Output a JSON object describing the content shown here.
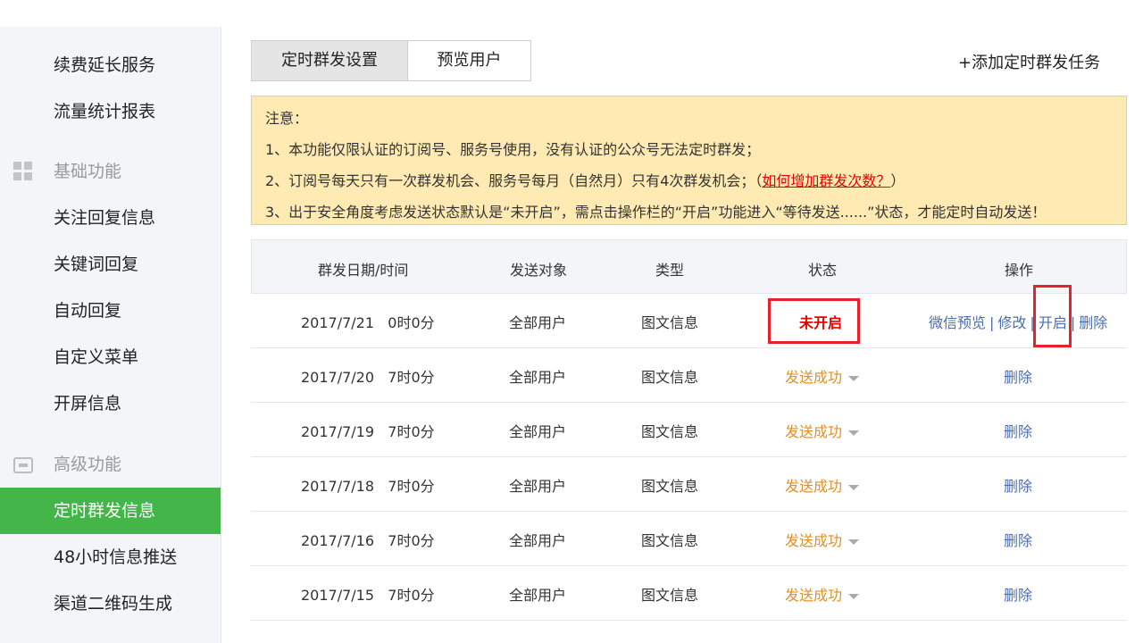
{
  "sidebar": {
    "items": [
      {
        "label": "续费延长服务"
      },
      {
        "label": "流量统计报表"
      },
      {
        "label": "基础功能"
      },
      {
        "label": "关注回复信息"
      },
      {
        "label": "关键词回复"
      },
      {
        "label": "自动回复"
      },
      {
        "label": "自定义菜单"
      },
      {
        "label": "开屏信息"
      },
      {
        "label": "高级功能"
      },
      {
        "label": "定时群发信息"
      },
      {
        "label": "48小时信息推送"
      },
      {
        "label": "渠道二维码生成"
      }
    ]
  },
  "tabs": [
    {
      "label": "定时群发设置"
    },
    {
      "label": "预览用户"
    }
  ],
  "add_task_label": "+添加定时群发任务",
  "notice": {
    "title": "注意：",
    "line1": "1、本功能仅限认证的订阅号、服务号使用，没有认证的公众号无法定时群发；",
    "line2_prefix": "2、订阅号每天只有一次群发机会、服务号每月（自然月）只有4次群发机会；（",
    "line2_link": "如何增加群发次数？",
    "line2_suffix": "）",
    "line3": "3、出于安全角度考虑发送状态默认是“未开启”，需点击操作栏的“开启”功能进入“等待发送......”状态，才能定时自动发送！"
  },
  "table": {
    "headers": {
      "datetime": "群发日期/时间",
      "target": "发送对象",
      "type": "类型",
      "status": "状态",
      "actions": "操作"
    },
    "rows": [
      {
        "datetime": "2017/7/21   0时0分",
        "target": "全部用户",
        "type": "图文信息",
        "status": "未开启",
        "actions": {
          "preview": "微信预览",
          "edit": "修改",
          "enable": "开启",
          "delete": "删除"
        }
      },
      {
        "datetime": "2017/7/20   7时0分",
        "target": "全部用户",
        "type": "图文信息",
        "status": "发送成功",
        "actions": {
          "delete": "删除"
        }
      },
      {
        "datetime": "2017/7/19   7时0分",
        "target": "全部用户",
        "type": "图文信息",
        "status": "发送成功",
        "actions": {
          "delete": "删除"
        }
      },
      {
        "datetime": "2017/7/18   7时0分",
        "target": "全部用户",
        "type": "图文信息",
        "status": "发送成功",
        "actions": {
          "delete": "删除"
        }
      },
      {
        "datetime": "2017/7/16   7时0分",
        "target": "全部用户",
        "type": "图文信息",
        "status": "发送成功",
        "actions": {
          "delete": "删除"
        }
      },
      {
        "datetime": "2017/7/15   7时0分",
        "target": "全部用户",
        "type": "图文信息",
        "status": "发送成功",
        "actions": {
          "delete": "删除"
        }
      }
    ],
    "separator": "|"
  },
  "colors": {
    "active_green": "#44b549",
    "status_success": "#e38f26",
    "status_off": "#e60000",
    "link_blue": "#4b6db1",
    "highlight_red": "#e8202a"
  }
}
